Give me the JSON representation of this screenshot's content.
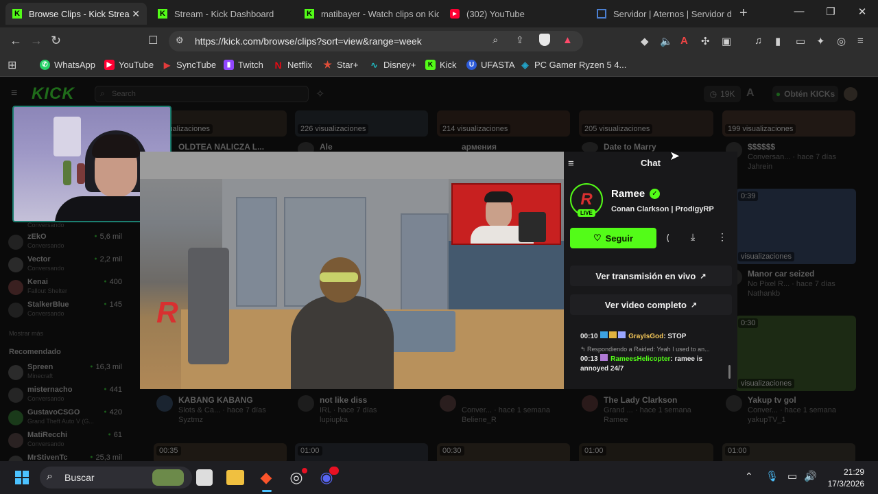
{
  "browser": {
    "tabs": [
      {
        "title": "Browse Clips - Kick Strea",
        "icon": "kick-icon",
        "active": true
      },
      {
        "title": "Stream - Kick Dashboard",
        "icon": "kick-icon",
        "active": false
      },
      {
        "title": "matibayer - Watch clips on Kic",
        "icon": "kick-icon",
        "active": false
      },
      {
        "title": "(302) YouTube",
        "icon": "youtube-icon",
        "active": false
      },
      {
        "title": "Servidor | Aternos | Servidor de",
        "icon": "aternos-icon",
        "active": false
      }
    ],
    "url": "https://kick.com/browse/clips?sort=view&range=week",
    "bookmarks": [
      {
        "label": "WhatsApp",
        "icon": "whatsapp-icon",
        "color": "#25d366"
      },
      {
        "label": "YouTube",
        "icon": "youtube-icon",
        "color": "#ff0033"
      },
      {
        "label": "SyncTube",
        "icon": "play-icon",
        "color": "#e23b3b"
      },
      {
        "label": "Twitch",
        "icon": "twitch-icon",
        "color": "#9146ff"
      },
      {
        "label": "Netflix",
        "icon": "netflix-icon",
        "color": "#e50914"
      },
      {
        "label": "Star+",
        "icon": "star-icon",
        "color": "#e04e39"
      },
      {
        "label": "Disney+",
        "icon": "disney-icon",
        "color": "#1ec0c8"
      },
      {
        "label": "Kick",
        "icon": "kick-icon",
        "color": "#53fc18"
      },
      {
        "label": "UFASTA",
        "icon": "ufasta-icon",
        "color": "#2d5bd8"
      },
      {
        "label": "PC Gamer Ryzen 5 4...",
        "icon": "pc-icon",
        "color": "#22a3c8"
      }
    ]
  },
  "kick": {
    "logo": "KICK",
    "search_placeholder": "Search",
    "viewers_badge": "19K",
    "obten_label": "Obtén KICKs"
  },
  "sidebar": {
    "following": [
      {
        "name": "",
        "sub": "Conversando",
        "count": ""
      },
      {
        "name": "zEkO",
        "sub": "Conversando",
        "count": "5,6 mil"
      },
      {
        "name": "Vector",
        "sub": "Conversando",
        "count": "2,2 mil"
      },
      {
        "name": "Kenai",
        "sub": "Fallout Shelter",
        "count": "400"
      },
      {
        "name": "StalkerBlue",
        "sub": "Conversando",
        "count": "145"
      }
    ],
    "show_more": "Mostrar más",
    "recommended_title": "Recomendado",
    "recommended": [
      {
        "name": "Spreen",
        "sub": "Minecraft",
        "count": "16,3 mil"
      },
      {
        "name": "misternacho",
        "sub": "Conversando",
        "count": "441"
      },
      {
        "name": "GustavoCSGO",
        "sub": "Grand Theft Auto V (G...",
        "count": "420"
      },
      {
        "name": "MatiRecchi",
        "sub": "Conversando",
        "count": "61"
      },
      {
        "name": "MrStivenTc",
        "sub": "",
        "count": "25,3 mil"
      }
    ]
  },
  "clips_top_row": [
    {
      "views": "visualizaciones",
      "title": "OLDTEA NALICZA L..."
    },
    {
      "views": "226 visualizaciones",
      "title": "Ale"
    },
    {
      "views": "214 visualizaciones",
      "title": "армения"
    },
    {
      "views": "205 visualizaciones",
      "title": "Date to Marry"
    },
    {
      "views": "199 visualizaciones",
      "title": "$$$$$$",
      "sub": "Conversan... · hace 7 días",
      "user": "Jahrein"
    }
  ],
  "clips_right_mid": [
    {
      "duration": "0:39",
      "views": "visualizaciones",
      "title": "Manor car seized",
      "sub": "No Pixel R... · hace 7 días",
      "user": "Nathankb"
    },
    {
      "duration": "0:30",
      "views": "visualizaciones",
      "title": "Yakup tv gol",
      "sub": "Conver... · hace 1 semana",
      "user": "yakupTV_1"
    }
  ],
  "clips_bottom_row": [
    {
      "title": "KABANG KABANG",
      "sub": "Slots & Ca... · hace 7 días",
      "user": "Syztmz"
    },
    {
      "title": "not like diss",
      "sub": "IRL · hace 7 días",
      "user": "lupiupka"
    },
    {
      "title": "",
      "sub": "Conver... · hace 1 semana",
      "user": "Beliene_R"
    },
    {
      "title": "The Lady Clarkson",
      "sub": "Grand ... · hace 1 semana",
      "user": "Ramee"
    }
  ],
  "clips_durations_bottom": [
    "00:35",
    "01:00",
    "00:30",
    "01:00",
    "01:00"
  ],
  "chat_panel": {
    "title": "Chat",
    "streamer": "Ramee",
    "live_label": "LIVE",
    "clip_title": "Conan Clarkson | ProdigyRP",
    "follow_label": "Seguir",
    "watch_live_label": "Ver transmisión en vivo",
    "watch_full_label": "Ver video completo",
    "messages": [
      {
        "time": "00:10",
        "user": "GrayIsGod",
        "text": ": STOP",
        "user_color": "#f6c859"
      },
      {
        "reply": "Respondiendo a Raided: Yeah I used to an...",
        "time": "00:13",
        "user": "RameesHelicopter",
        "text": ": ramee is",
        "text2": "annoyed 24/7",
        "user_color": "#53fc18"
      }
    ]
  },
  "taskbar": {
    "search_label": "Buscar",
    "time": "21:29",
    "date": "17/3/2026"
  }
}
